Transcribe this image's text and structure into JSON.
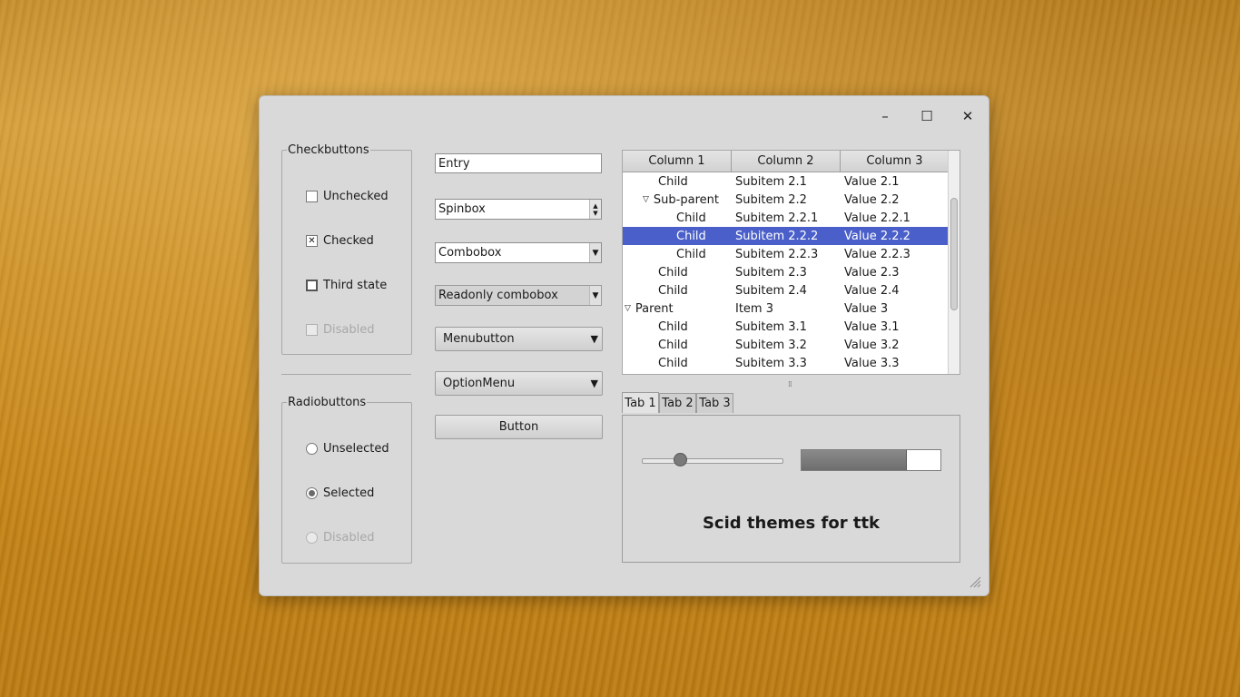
{
  "window": {
    "controls": {
      "minimize": "–",
      "maximize": "☐",
      "close": "✕"
    }
  },
  "checkbuttons": {
    "title": "Checkbuttons",
    "items": [
      {
        "label": "Unchecked",
        "state": "unchecked"
      },
      {
        "label": "Checked",
        "state": "checked",
        "mark": "✕"
      },
      {
        "label": "Third state",
        "state": "tristate"
      },
      {
        "label": "Disabled",
        "state": "disabled"
      }
    ]
  },
  "radiobuttons": {
    "title": "Radiobuttons",
    "items": [
      {
        "label": "Unselected",
        "state": "unselected"
      },
      {
        "label": "Selected",
        "state": "selected"
      },
      {
        "label": "Disabled",
        "state": "disabled"
      }
    ]
  },
  "widgets": {
    "entry_value": "Entry",
    "spinbox_value": "Spinbox",
    "spin_up": "▲",
    "spin_down": "▼",
    "combobox_value": "Combobox",
    "readonly_combobox_value": "Readonly combobox",
    "menubutton_label": "Menubutton",
    "optionmenu_label": "OptionMenu",
    "button_label": "Button",
    "dropdown_arrow": "▼"
  },
  "tree": {
    "columns": [
      "Column 1",
      "Column 2",
      "Column 3"
    ],
    "rows": [
      {
        "c1": "Child",
        "c2": "Subitem 2.1",
        "c3": "Value 2.1",
        "level": 1,
        "toggle": "",
        "selected": false
      },
      {
        "c1": "Sub-parent",
        "c2": "Subitem 2.2",
        "c3": "Value 2.2",
        "level": 1,
        "toggle": "▽",
        "selected": false
      },
      {
        "c1": "Child",
        "c2": "Subitem 2.2.1",
        "c3": "Value 2.2.1",
        "level": 2,
        "toggle": "",
        "selected": false
      },
      {
        "c1": "Child",
        "c2": "Subitem 2.2.2",
        "c3": "Value 2.2.2",
        "level": 2,
        "toggle": "",
        "selected": true
      },
      {
        "c1": "Child",
        "c2": "Subitem 2.2.3",
        "c3": "Value 2.2.3",
        "level": 2,
        "toggle": "",
        "selected": false
      },
      {
        "c1": "Child",
        "c2": "Subitem 2.3",
        "c3": "Value 2.3",
        "level": 1,
        "toggle": "",
        "selected": false
      },
      {
        "c1": "Child",
        "c2": "Subitem 2.4",
        "c3": "Value 2.4",
        "level": 1,
        "toggle": "",
        "selected": false
      },
      {
        "c1": "Parent",
        "c2": "Item 3",
        "c3": "Value 3",
        "level": 0,
        "toggle": "▽",
        "selected": false
      },
      {
        "c1": "Child",
        "c2": "Subitem 3.1",
        "c3": "Value 3.1",
        "level": 1,
        "toggle": "",
        "selected": false
      },
      {
        "c1": "Child",
        "c2": "Subitem 3.2",
        "c3": "Value 3.2",
        "level": 1,
        "toggle": "",
        "selected": false
      },
      {
        "c1": "Child",
        "c2": "Subitem 3.3",
        "c3": "Value 3.3",
        "level": 1,
        "toggle": "",
        "selected": false
      }
    ],
    "pane_grip": "⁞⁞"
  },
  "notebook": {
    "tabs": [
      "Tab 1",
      "Tab 2",
      "Tab 3"
    ],
    "active_tab": 0,
    "scale_value": 0.27,
    "progress_value": 0.75,
    "caption": "Scid themes for ttk"
  },
  "colors": {
    "selection": "#4a5fc9",
    "window_bg": "#d9d9d9"
  }
}
